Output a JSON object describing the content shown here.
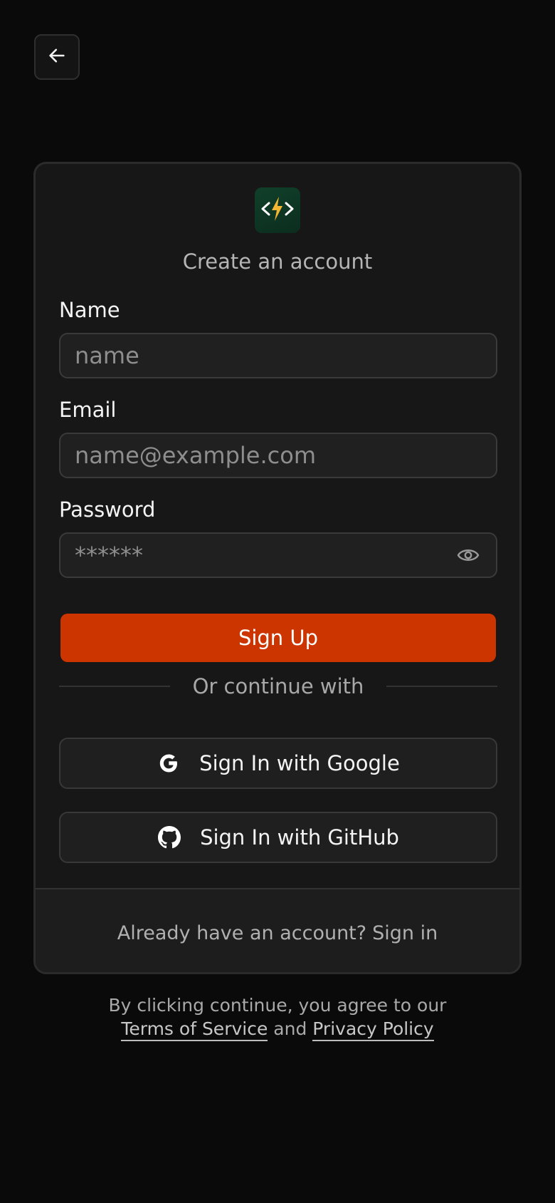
{
  "header": {
    "back_icon": "arrow-left-icon"
  },
  "card": {
    "logo_icon": "code-bolt-icon",
    "subtitle": "Create an account",
    "name": {
      "label": "Name",
      "placeholder": "name",
      "value": ""
    },
    "email": {
      "label": "Email",
      "placeholder": "name@example.com",
      "value": ""
    },
    "password": {
      "label": "Password",
      "placeholder": "******",
      "value": "",
      "toggle_icon": "eye-icon"
    },
    "signup_label": "Sign Up",
    "divider_text": "Or continue with",
    "google_label": "Sign In with Google",
    "github_label": "Sign In with GitHub",
    "footer": {
      "prompt": "Already have an account?",
      "signin_link": "Sign in"
    }
  },
  "legal": {
    "line1": "By clicking continue, you agree to our",
    "terms_link": "Terms of Service",
    "and": "and",
    "privacy_link": "Privacy Policy"
  },
  "colors": {
    "background": "#0a0a0a",
    "card": "#171717",
    "accent": "#cc3400",
    "logo_bg": "#10402a",
    "logo_bolt": "#f2b632"
  }
}
